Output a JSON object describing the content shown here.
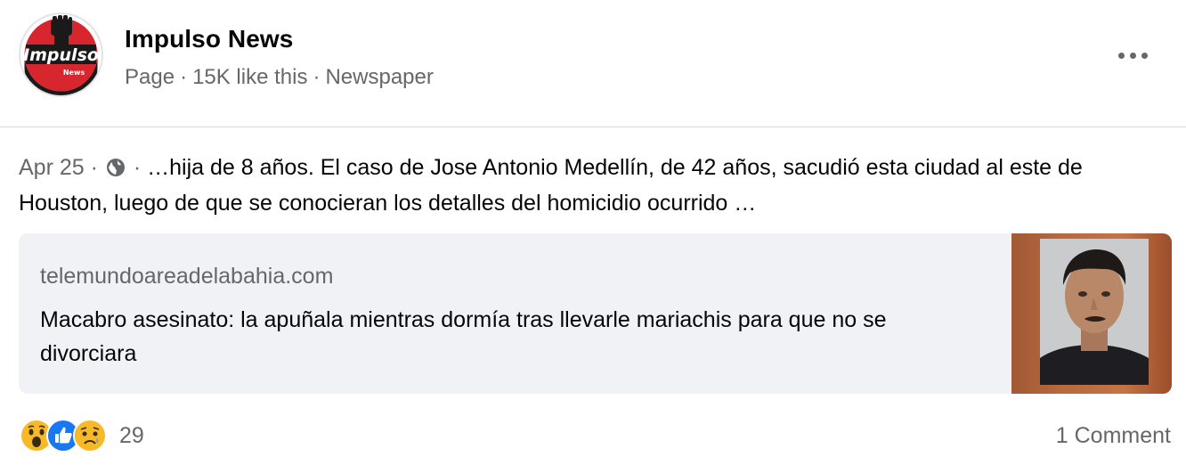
{
  "page": {
    "name": "Impulso News",
    "type": "Page",
    "likes": "15K like this",
    "category": "Newspaper",
    "logo_text": "Impulso",
    "logo_subtext": "News"
  },
  "post": {
    "date": "Apr 25",
    "separator": "·",
    "privacy_icon": "globe-icon",
    "text": "…hija de 8 años. El caso de Jose Antonio Medellín, de 42 años, sacudió esta ciudad al este de Houston, luego de que se conocieran los detalles del homicidio ocurrido …"
  },
  "link_preview": {
    "domain": "telemundoareadelabahia.com",
    "title": "Macabro asesinato: la apuñala mientras dormía tras llevarle mariachis para que no se divorciara",
    "thumbnail": "mugshot-photo"
  },
  "engagement": {
    "reactions": [
      "wow-reaction-icon",
      "like-reaction-icon",
      "sad-reaction-icon"
    ],
    "reaction_count": "29",
    "comments": "1 Comment"
  },
  "colors": {
    "secondary_text": "#65676b",
    "card_bg": "#f0f2f5",
    "like_blue": "#1877f2",
    "reaction_yellow": "#f7b928",
    "logo_red": "#d7262d"
  }
}
